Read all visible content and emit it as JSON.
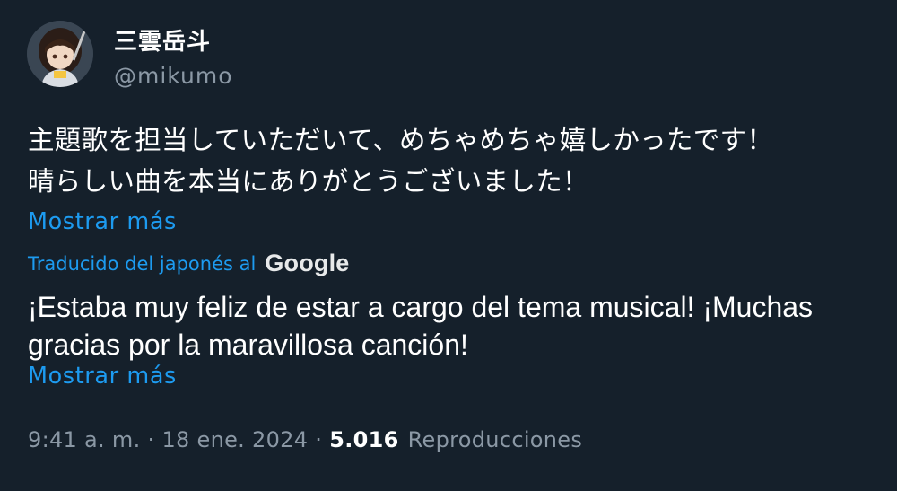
{
  "user": {
    "display_name": "三雲岳斗",
    "handle": "@mikumo",
    "avatar_icon": "profile-avatar"
  },
  "tweet": {
    "original_text": "主題歌を担当していただいて、めちゃめちゃ嬉しかったです！\n晴らしい曲を本当にありがとうございました！",
    "show_more_label": "Mostrar más",
    "translated_by_label": "Traducido del japonés al",
    "translator_name": "Google",
    "translated_text": "¡Estaba muy feliz de estar a cargo del tema musical! ¡Muchas\ngracias por la maravillosa canción!",
    "show_more_label_2": "Mostrar más"
  },
  "meta": {
    "time": "9:41 a. m.",
    "separator": "·",
    "date": "18 ene. 2024",
    "views_count": "5.016",
    "views_label": "Reproducciones"
  },
  "colors": {
    "background": "#15202b",
    "link": "#1d9bf0",
    "secondary_text": "#8b98a5",
    "primary_text": "#ffffff"
  }
}
